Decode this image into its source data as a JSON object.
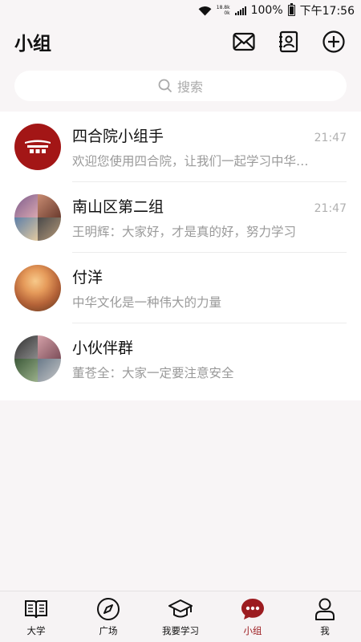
{
  "status_bar": {
    "speed_top": "18.8k",
    "speed_bottom": "0k",
    "battery": "100%",
    "time": "下午17:56"
  },
  "header": {
    "title": "小组"
  },
  "search": {
    "placeholder": "搜索"
  },
  "chats": [
    {
      "name": "四合院小组手",
      "time": "21:47",
      "message": "欢迎您使用四合院，让我们一起学习中华…",
      "avatar": "system-logo"
    },
    {
      "name": "南山区第二组",
      "time": "21:47",
      "message": "王明辉：大家好，才是真的好，努力学习",
      "avatar": "group-collage"
    },
    {
      "name": "付洋",
      "time": "",
      "message": "中华文化是一种伟大的力量",
      "avatar": "sunset-photo"
    },
    {
      "name": "小伙伴群",
      "time": "",
      "message": "董苍全：大家一定要注意安全",
      "avatar": "group-collage"
    }
  ],
  "tabs": [
    {
      "label": "大学",
      "icon": "book-icon",
      "active": false
    },
    {
      "label": "广场",
      "icon": "compass-icon",
      "active": false
    },
    {
      "label": "我要学习",
      "icon": "graduation-cap-icon",
      "active": false
    },
    {
      "label": "小组",
      "icon": "chat-bubble-icon",
      "active": true
    },
    {
      "label": "我",
      "icon": "person-icon",
      "active": false
    }
  ],
  "colors": {
    "accent": "#9c1c20",
    "background": "#f8f5f6"
  }
}
